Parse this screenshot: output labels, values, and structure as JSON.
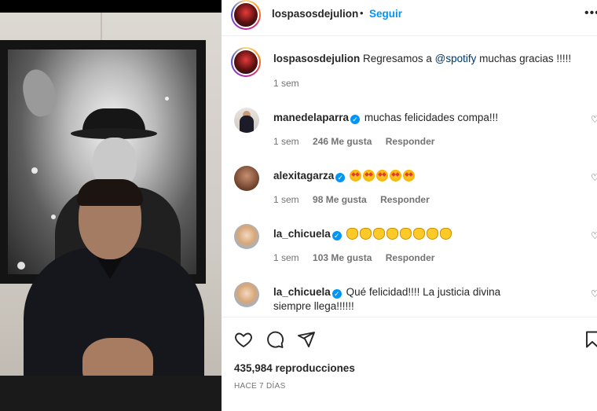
{
  "post": {
    "author": "lospasosdejulion",
    "follow_label": "Seguir",
    "separator": "•",
    "more_label": "•••",
    "caption_user": "lospasosdejulion",
    "caption_before": "Regresamos a",
    "caption_mention": "@spotify",
    "caption_after": "muchas gracias !!!!!",
    "caption_time": "1 sem"
  },
  "comments": [
    {
      "user": "manedelaparra",
      "text": "muchas felicidades compa!!!",
      "time": "1 sem",
      "likes": "246 Me gusta",
      "reply": "Responder",
      "avatar_icon": "user-avatar"
    },
    {
      "user": "alexitagarza",
      "emoji_name": "star-struck-emoji",
      "emoji_count": 5,
      "time": "1 sem",
      "likes": "98 Me gusta",
      "reply": "Responder",
      "avatar_icon": "user-avatar"
    },
    {
      "user": "la_chicuela",
      "emoji_name": "clapping-hands-emoji",
      "emoji_count": 8,
      "time": "1 sem",
      "likes": "103 Me gusta",
      "reply": "Responder",
      "avatar_icon": "user-avatar"
    },
    {
      "user": "la_chicuela",
      "text": "Qué felicidad!!!! La justicia divina siempre llega!!!!!!",
      "avatar_icon": "user-avatar"
    }
  ],
  "stats": {
    "views": "435,984 reproducciones",
    "posted": "HACE 7 DÍAS"
  },
  "icons": {
    "verified": "verified-badge-icon",
    "like": "heart-icon",
    "comment": "comment-icon",
    "share": "share-icon",
    "save": "bookmark-icon"
  },
  "colors": {
    "link": "#0095f6",
    "mention": "#00376b",
    "muted": "#737373",
    "text": "#262626"
  }
}
